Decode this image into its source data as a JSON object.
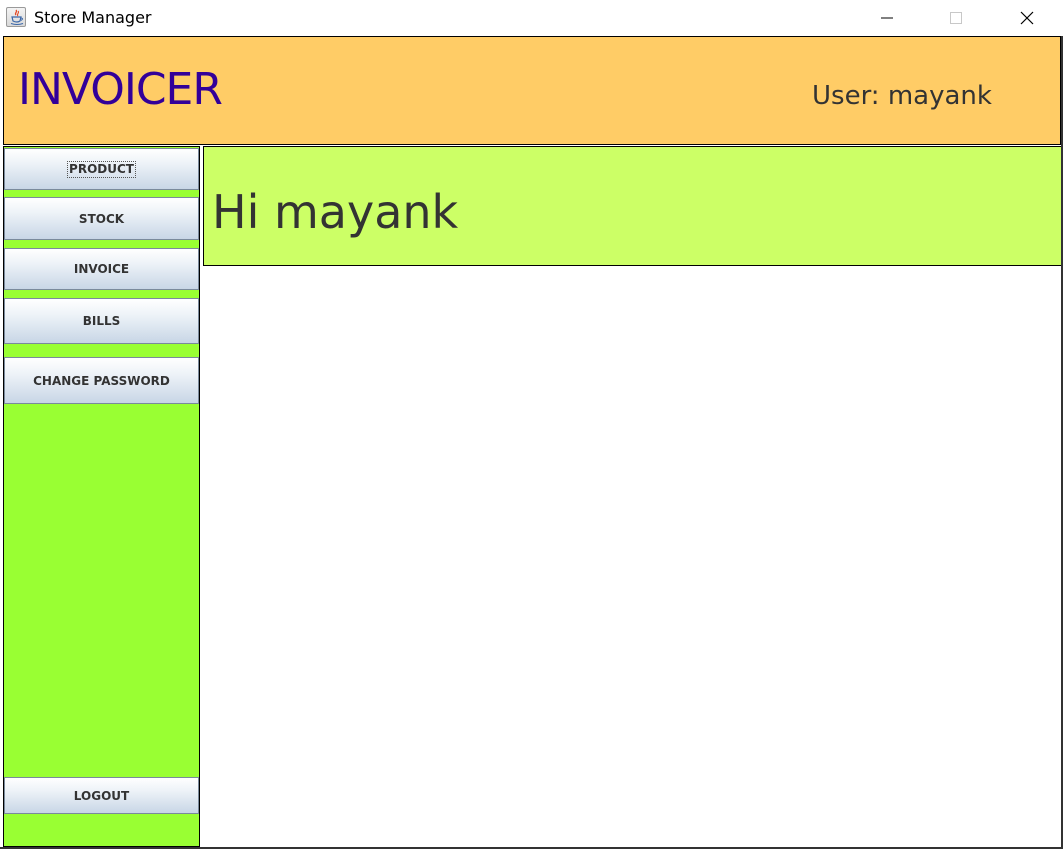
{
  "window": {
    "title": "Store Manager",
    "icon": "java-cup-icon",
    "controls": [
      "minimize-icon",
      "maximize-icon",
      "close-icon"
    ]
  },
  "header": {
    "brand": "INVOICER",
    "user_label": "User: mayank",
    "background": "#ffcc66",
    "brand_color": "#330099"
  },
  "sidebar": {
    "background": "#99ff33",
    "items": [
      {
        "label": "PRODUCT",
        "focused": true
      },
      {
        "label": "STOCK"
      },
      {
        "label": "INVOICE"
      },
      {
        "label": "BILLS"
      },
      {
        "label": "CHANGE PASSWORD"
      }
    ],
    "logout_label": "LOGOUT"
  },
  "main": {
    "greeting": "Hi mayank",
    "greeting_background": "#ccff66"
  }
}
